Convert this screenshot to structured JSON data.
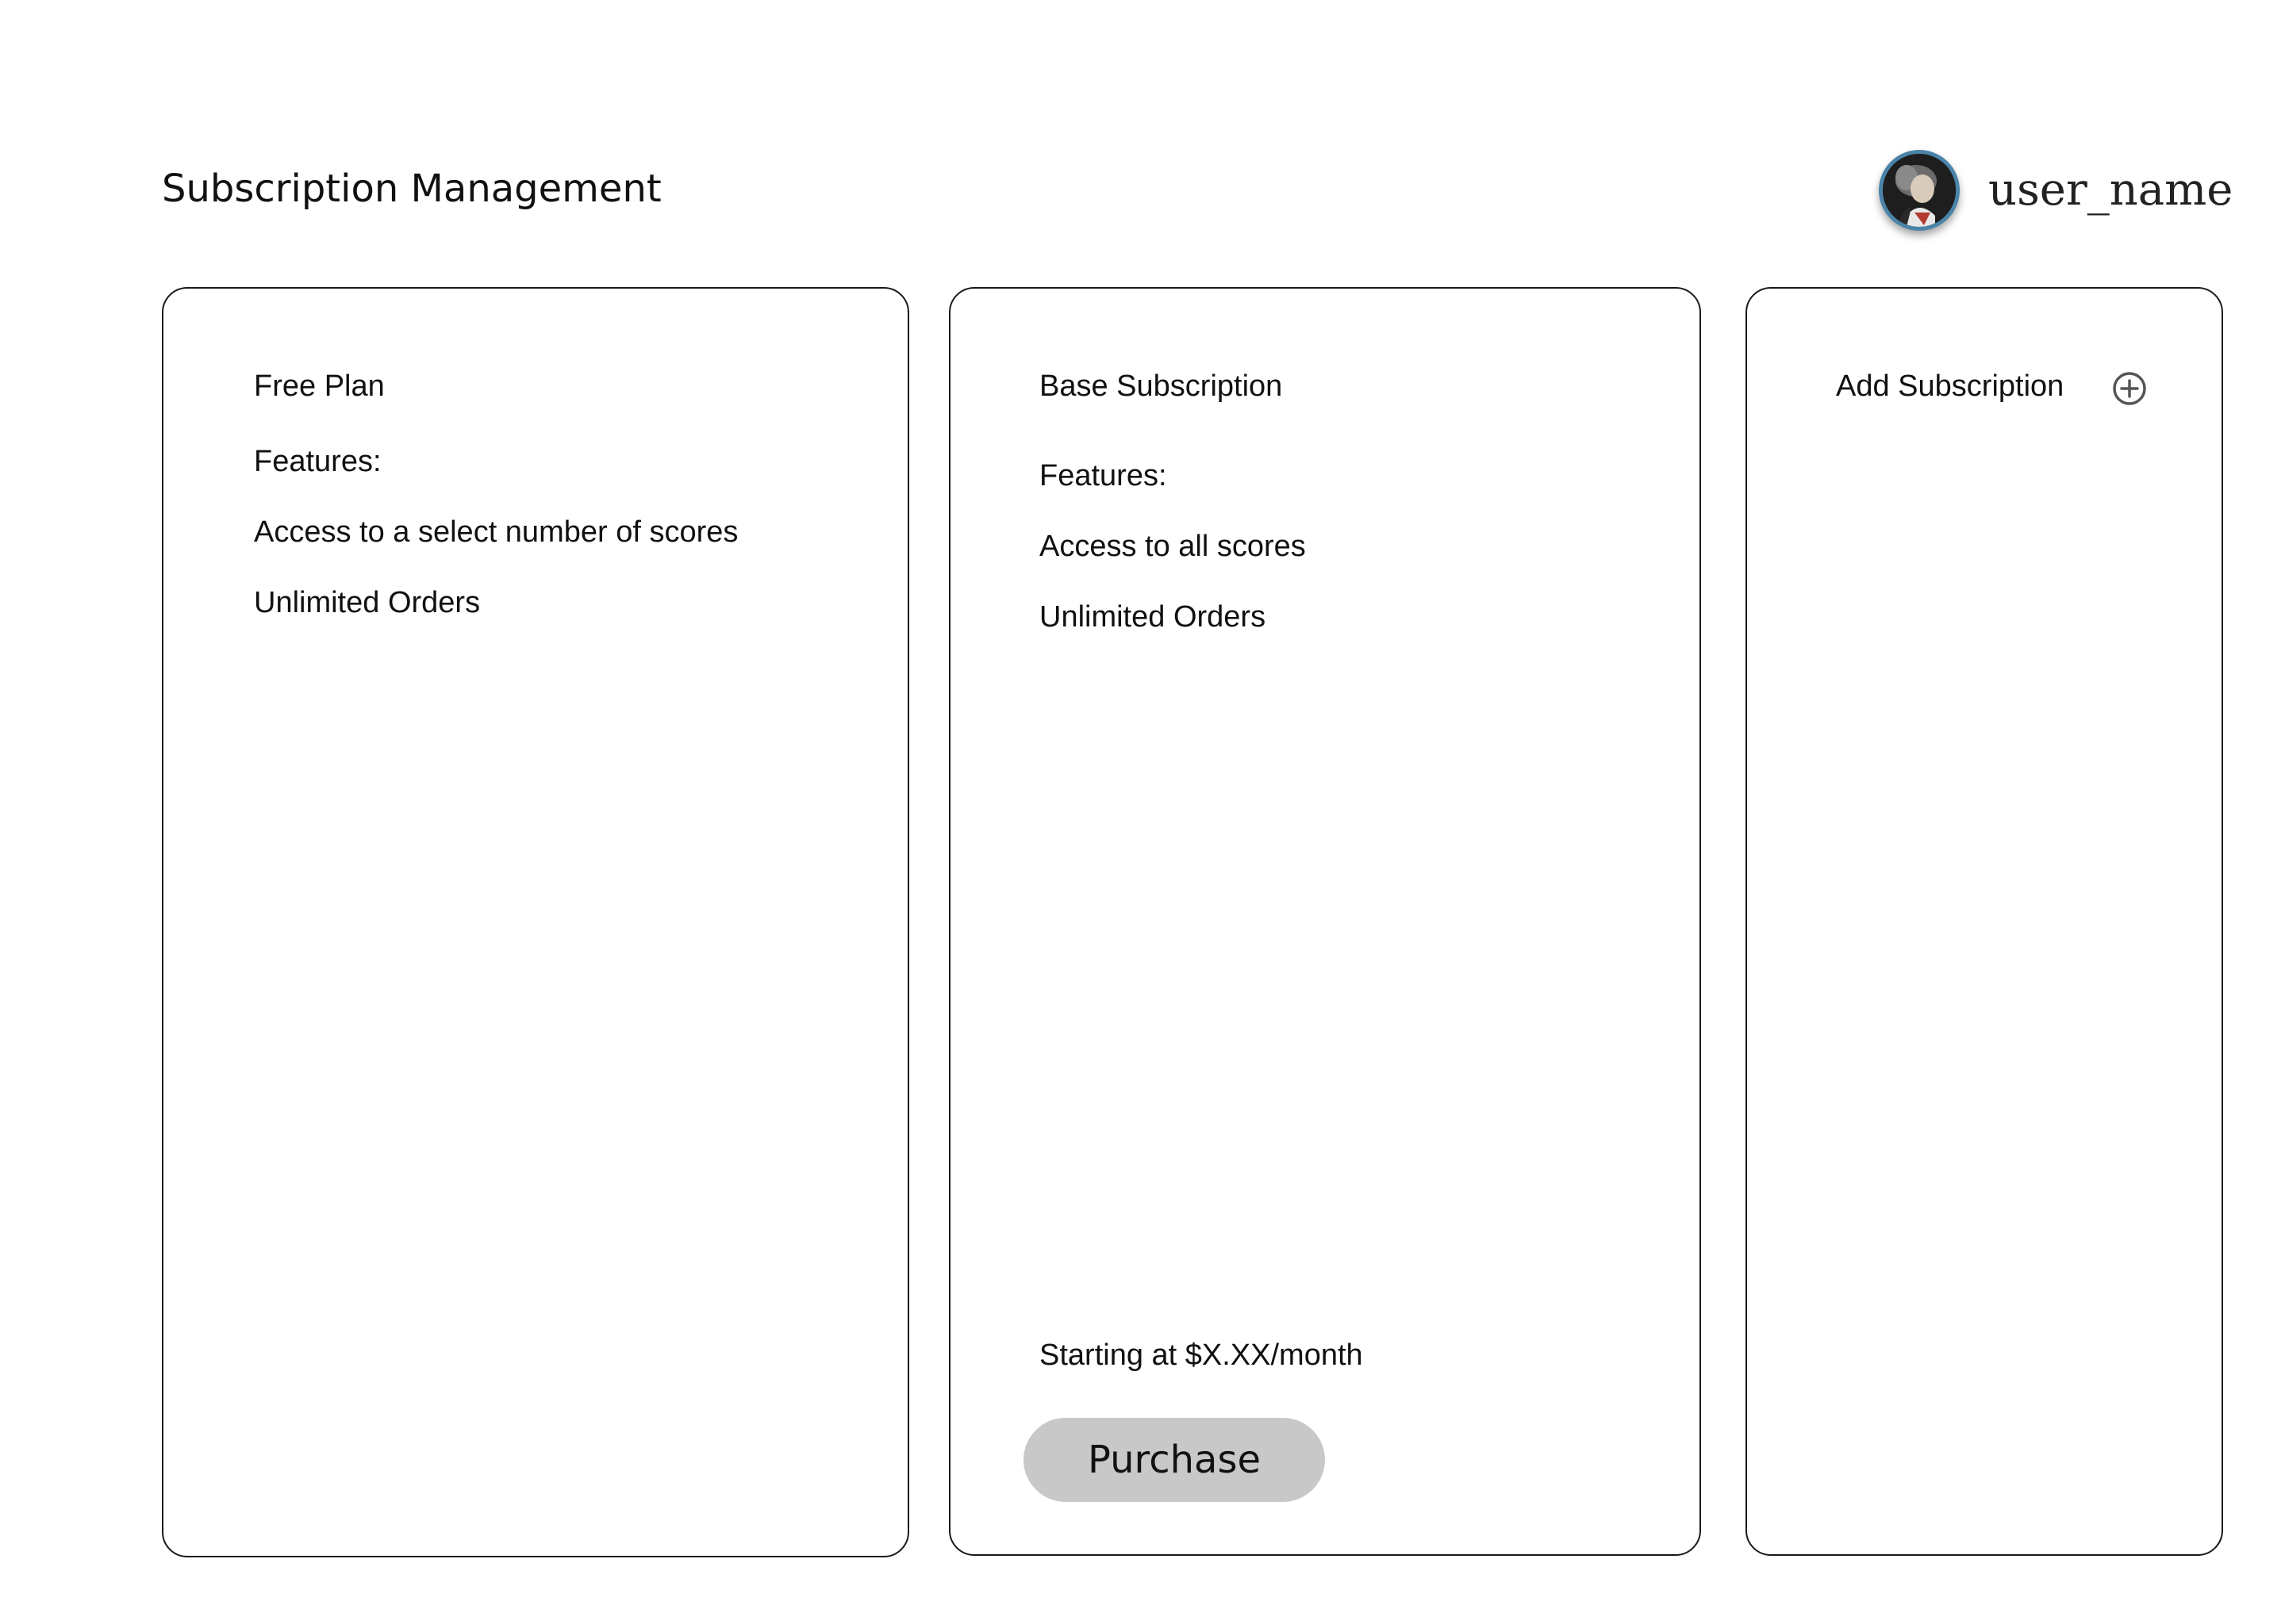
{
  "header": {
    "title": "Subscription Management",
    "user_name": "user_name",
    "avatar_icon": "user-avatar-portrait"
  },
  "plans": {
    "free": {
      "title": "Free Plan",
      "features_label": "Features:",
      "features": [
        "Access to a select number of scores",
        "Unlimited Orders"
      ]
    },
    "base": {
      "title": "Base Subscription",
      "features_label": "Features:",
      "features": [
        "Access to all scores",
        "Unlimited Orders"
      ],
      "price_text": "Starting at $X.XX/month",
      "purchase_label": "Purchase"
    },
    "add": {
      "title": "Add Subscription",
      "icon": "plus-circle-icon"
    }
  },
  "colors": {
    "button_bg": "#c8c8c8",
    "card_border": "#1a1a1a",
    "avatar_ring": "#4a84a8"
  }
}
